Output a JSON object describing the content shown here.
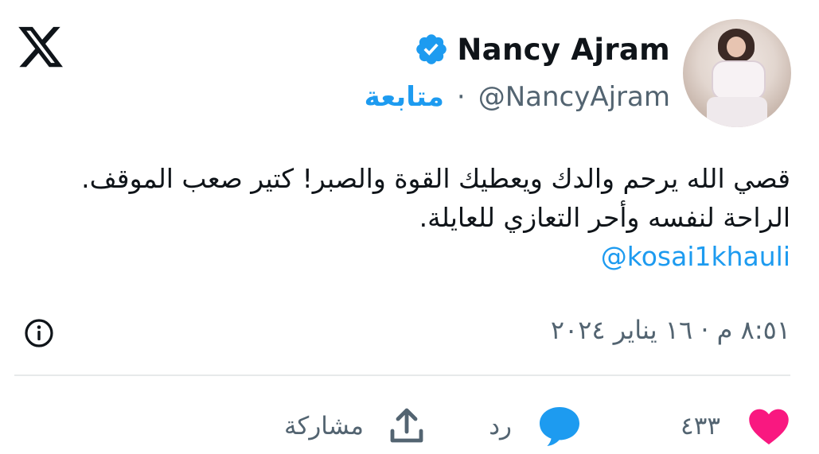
{
  "tweet": {
    "author": {
      "display_name": "Nancy Ajram",
      "handle": "@NancyAjram",
      "separator": "·",
      "follow_label": "متابعة"
    },
    "text_lines": [
      "قصي الله يرحم والدك ويعطيك القوة والصبر! كتير صعب الموقف.",
      "الراحة لنفسه وأحر التعازي للعايلة."
    ],
    "mention": "@kosai1khauli",
    "timestamp": "٨:٥١ م · ١٦ يناير ٢٠٢٤",
    "actions": {
      "likes_count": "٤٣٣",
      "reply_label": "رد",
      "share_label": "مشاركة"
    }
  },
  "colors": {
    "accent": "#1d9bf0",
    "like": "#f91880",
    "secondary_text": "#536471",
    "divider": "#e7e9ea"
  },
  "icons": [
    "x-logo-icon",
    "verified-badge-icon",
    "info-icon",
    "heart-icon",
    "reply-bubble-icon",
    "share-icon"
  ]
}
